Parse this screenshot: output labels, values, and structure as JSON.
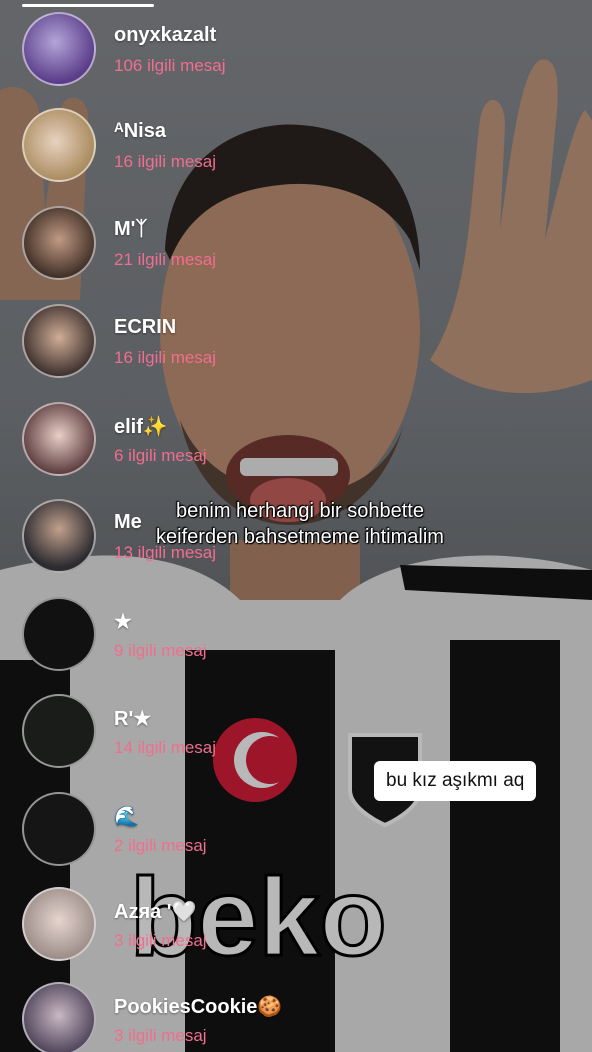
{
  "chats": [
    {
      "name": "onyxkazalt",
      "count": "106 ilgili mesaj"
    },
    {
      "name": "ᴬNisa",
      "count": "16 ilgili mesaj"
    },
    {
      "name": "M'ᛉ",
      "count": "21 ilgili mesaj"
    },
    {
      "name": "ECRIN",
      "count": "16 ilgili mesaj"
    },
    {
      "name": "elif✨",
      "count": "6 ilgili mesaj"
    },
    {
      "name": "Me",
      "count": "13 ilgili mesaj"
    },
    {
      "name": "★",
      "count": "9 ilgili mesaj"
    },
    {
      "name": "R'★",
      "count": "14 ilgili mesaj"
    },
    {
      "name": "🌊",
      "count": "2 ilgili mesaj"
    },
    {
      "name": "Azяa '🤍",
      "count": "3 ilgili mesaj"
    },
    {
      "name": "PookiesCookie🍪",
      "count": "3 ilgili mesaj"
    }
  ],
  "overlay": {
    "caption_line1": "benim herhangi bir sohbette",
    "caption_line2": "keiferden bahsetmeme ihtimalim",
    "sticker": "bu kız aşıkmı aq"
  },
  "colors": {
    "count_text": "#f06e8f",
    "name_text": "#ffffff"
  }
}
